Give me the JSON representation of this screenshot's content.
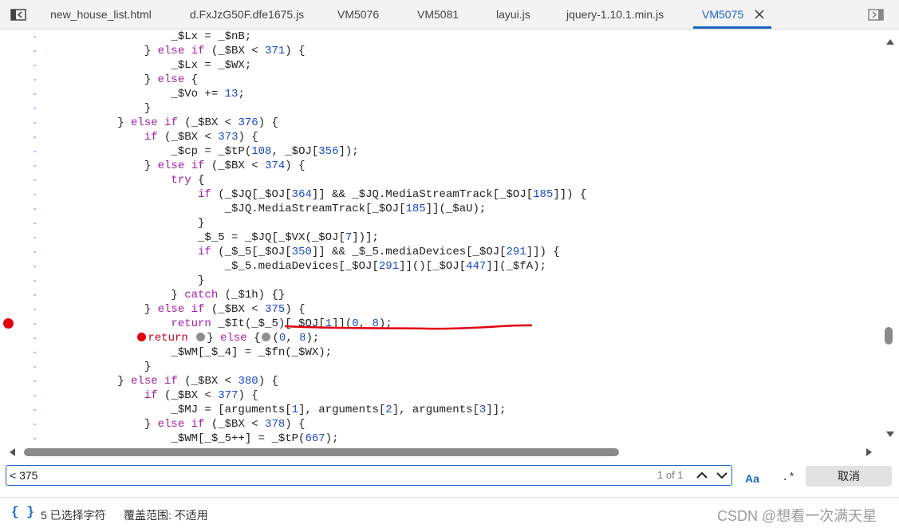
{
  "tabs": [
    {
      "label": "new_house_list.html"
    },
    {
      "label": "d.FxJzG50F.dfe1675.js"
    },
    {
      "label": "VM5076"
    },
    {
      "label": "VM5081"
    },
    {
      "label": "layui.js"
    },
    {
      "label": "jquery-1.10.1.min.js"
    },
    {
      "label": "VM5075",
      "active": true
    }
  ],
  "code": {
    "gutter_marker": "-",
    "lines": [
      "                _$Lx = _$nB;",
      "            } else if (_$BX < 371) {",
      "                _$Lx = _$WX;",
      "            } else {",
      "                _$Vo += 13;",
      "            }",
      "        } else if (_$BX < 376) {",
      "            if (_$BX < 373) {",
      "                _$cp = _$tP(108, _$OJ[356]);",
      "            } else if (_$BX < 374) {",
      "                try {",
      "                    if (_$JQ[_$OJ[364]] && _$JQ.MediaStreamTrack[_$OJ[185]]) {",
      "                        _$JQ.MediaStreamTrack[_$OJ[185]](_$aU);",
      "                    }",
      "                    _$_5 = _$JQ[_$VX(_$OJ[7])];",
      "                    if (_$_5[_$OJ[350]] && _$_5.mediaDevices[_$OJ[291]]) {",
      "                        _$_5.mediaDevices[_$OJ[291]]()[_$OJ[447]](_$fA);",
      "                    }",
      "                } catch (_$1h) {}",
      "            } else if (_$BX < 375) {",
      "                return _$It(_$_5)[_$OJ[1]](0, 8);",
      "            } else {",
      "                _$WM[_$_4] = _$fn(_$WX);",
      "            }",
      "        } else if (_$BX < 380) {",
      "            if (_$BX < 377) {",
      "                _$MJ = [arguments[1], arguments[2], arguments[3]];",
      "            } else if (_$BX < 378) {",
      "                _$WM[_$_5++] = _$tP(667);"
    ],
    "breakpoint_line": 21,
    "highlight_text": "< 375"
  },
  "search": {
    "value": "< 375",
    "count": "1 of 1",
    "match_case_label": "Aa",
    "regex_label": ".*",
    "cancel_label": "取消"
  },
  "status": {
    "braces_icon": "{ }",
    "selection": "5 已选择字符",
    "coverage": "覆盖范围: 不适用",
    "watermark": "CSDN @想看一次满天星"
  },
  "colors": {
    "accent": "#1a66c2",
    "breakpoint": "#e0000f",
    "keyword": "#a11fa8",
    "number": "#1a49c7"
  }
}
